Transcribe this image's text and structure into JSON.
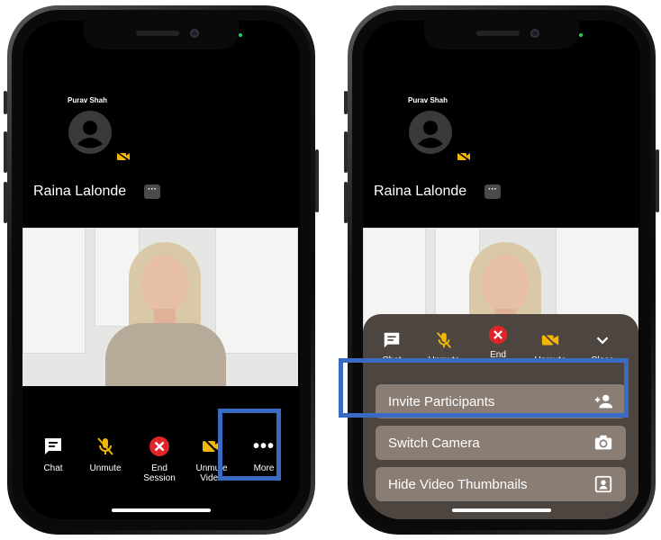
{
  "left_phone": {
    "participant_name": "Purav Shah",
    "host_name": "Raina Lalonde",
    "host_more": "···",
    "toolbar": {
      "chat": "Chat",
      "unmute": "Unmute",
      "end_session_line1": "End",
      "end_session_line2": "Session",
      "unmute_video_line1": "Unmute",
      "unmute_video_line2": "Video",
      "more": "More"
    }
  },
  "right_phone": {
    "participant_name": "Purav Shah",
    "host_name": "Raina Lalonde",
    "host_more": "···",
    "sheet": {
      "chat": "Chat",
      "unmute": "Unmute",
      "end": "End",
      "unmute_video": "Unmute",
      "close": "Close"
    },
    "menu": [
      {
        "label": "Invite Participants",
        "icon": "add-person-icon"
      },
      {
        "label": "Switch Camera",
        "icon": "switch-camera-icon"
      },
      {
        "label": "Hide Video Thumbnails",
        "icon": "portrait-icon"
      }
    ]
  },
  "colors": {
    "highlight": "#3a6bc2",
    "end_red": "#e0242b",
    "muted_yellow": "#f2b705",
    "sheet_bg": "#4d4540",
    "menu_item_bg": "#8a7d74"
  }
}
